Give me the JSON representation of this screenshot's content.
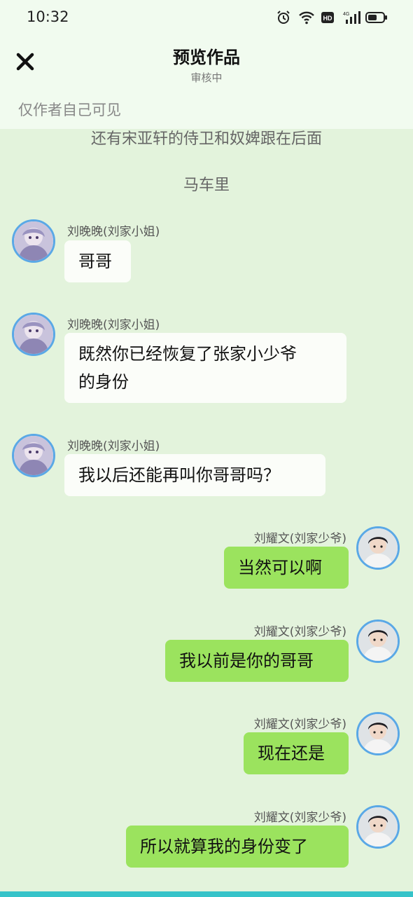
{
  "status": {
    "time": "10:32",
    "icons": [
      "alarm-icon",
      "wifi-icon",
      "hd-icon",
      "signal-4g-icon",
      "battery-icon"
    ]
  },
  "header": {
    "close_icon": "close-icon",
    "title": "预览作品",
    "subtitle": "审核中",
    "visibility": "仅作者自己可见"
  },
  "narrations": [
    "还有宋亚轩的侍卫和奴婢跟在后面",
    "马车里"
  ],
  "messages": [
    {
      "side": "left",
      "name": "刘晚晚(刘家小姐)",
      "lines": [
        "哥哥"
      ]
    },
    {
      "side": "left",
      "name": "刘晚晚(刘家小姐)",
      "lines": [
        "既然你已经恢复了张家小少爷",
        "的身份"
      ]
    },
    {
      "side": "left",
      "name": "刘晚晚(刘家小姐)",
      "lines": [
        "我以后还能再叫你哥哥吗？"
      ]
    },
    {
      "side": "right",
      "name": "刘耀文(刘家少爷)",
      "lines": [
        "当然可以啊"
      ]
    },
    {
      "side": "right",
      "name": "刘耀文(刘家少爷)",
      "lines": [
        "我以前是你的哥哥"
      ]
    },
    {
      "side": "right",
      "name": "刘耀文(刘家少爷)",
      "lines": [
        "现在还是"
      ]
    },
    {
      "side": "right",
      "name": "刘耀文(刘家少爷)",
      "lines": [
        "所以就算我的身份变了"
      ]
    }
  ],
  "colors": {
    "background": "#e3f3dc",
    "left_bubble": "#fbfdf9",
    "right_bubble": "#9be35e",
    "avatar_border": "#5aa8e6"
  }
}
